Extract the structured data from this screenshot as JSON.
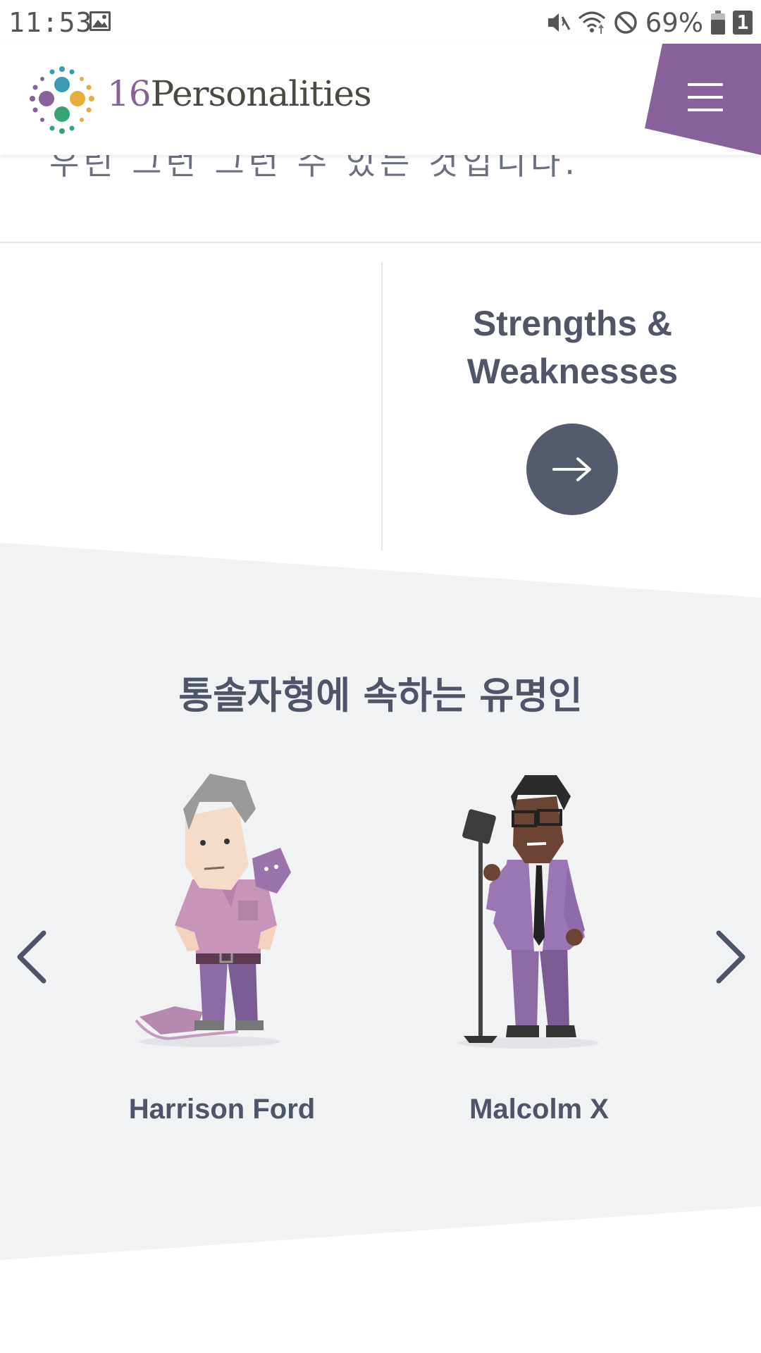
{
  "status_bar": {
    "time": "11:53",
    "battery_percent": "69%",
    "sim_badge": "1",
    "icons": [
      "gallery-icon",
      "mute-icon",
      "wifi-icon",
      "do-not-disturb-icon",
      "battery-icon"
    ]
  },
  "header": {
    "logo_number": "16",
    "logo_word": "Personalities",
    "menu_icon": "hamburger-menu-icon",
    "menu_color": "#88619a"
  },
  "cut_text": "우린 그런 그런 수 있는 것입니다.",
  "card": {
    "title_line1": "Strengths &",
    "title_line2": "Weaknesses",
    "button_icon": "arrow-right-icon"
  },
  "famous": {
    "title": "통솔자형에 속하는 유명인",
    "people": [
      {
        "name": "Harrison Ford"
      },
      {
        "name": "Malcolm X"
      }
    ],
    "prev_icon": "chevron-left-icon",
    "next_icon": "chevron-right-icon"
  },
  "colors": {
    "accent_purple": "#88619a",
    "button_dark": "#545b6d",
    "section_gray": "#f1f2f4",
    "text": "#4f5568"
  }
}
